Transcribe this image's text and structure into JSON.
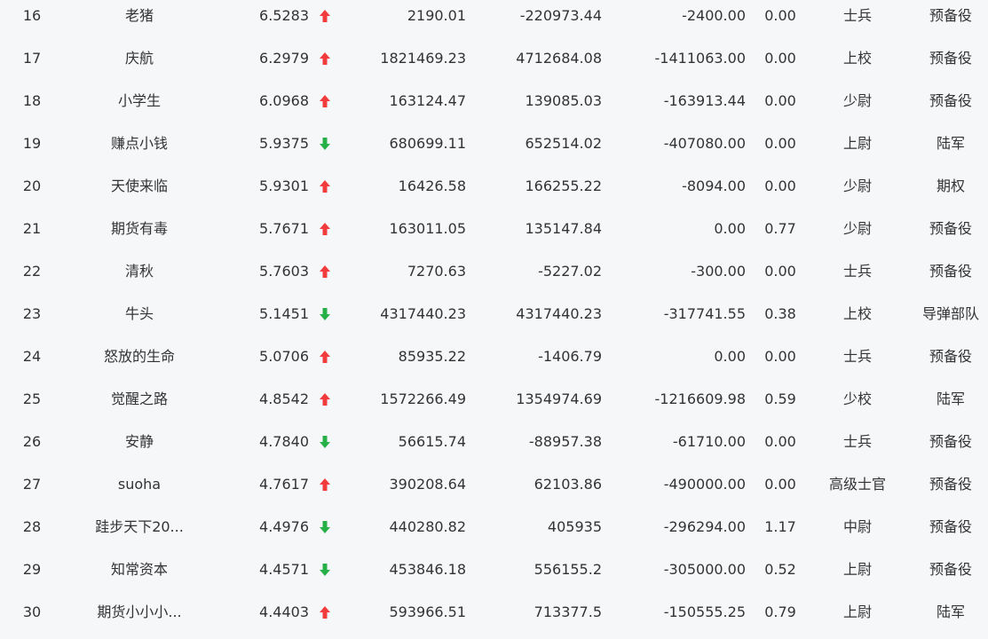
{
  "colors": {
    "up": "#f23c3c",
    "down": "#28b048",
    "text": "#333333",
    "background": "#f6f7f9"
  },
  "rows": [
    {
      "rank": "16",
      "name": "老猪",
      "score": "6.5283",
      "trend": "up",
      "value1": "2190.01",
      "value2": "-220973.44",
      "value3": "-2400.00",
      "ratio": "0.00",
      "rank_title": "士兵",
      "unit": "预备役"
    },
    {
      "rank": "17",
      "name": "庆航",
      "score": "6.2979",
      "trend": "up",
      "value1": "1821469.23",
      "value2": "4712684.08",
      "value3": "-1411063.00",
      "ratio": "0.00",
      "rank_title": "上校",
      "unit": "预备役"
    },
    {
      "rank": "18",
      "name": "小学生",
      "score": "6.0968",
      "trend": "up",
      "value1": "163124.47",
      "value2": "139085.03",
      "value3": "-163913.44",
      "ratio": "0.00",
      "rank_title": "少尉",
      "unit": "预备役"
    },
    {
      "rank": "19",
      "name": "赚点小钱",
      "score": "5.9375",
      "trend": "down",
      "value1": "680699.11",
      "value2": "652514.02",
      "value3": "-407080.00",
      "ratio": "0.00",
      "rank_title": "上尉",
      "unit": "陆军"
    },
    {
      "rank": "20",
      "name": "天使来临",
      "score": "5.9301",
      "trend": "up",
      "value1": "16426.58",
      "value2": "166255.22",
      "value3": "-8094.00",
      "ratio": "0.00",
      "rank_title": "少尉",
      "unit": "期权"
    },
    {
      "rank": "21",
      "name": "期货有毒",
      "score": "5.7671",
      "trend": "up",
      "value1": "163011.05",
      "value2": "135147.84",
      "value3": "0.00",
      "ratio": "0.77",
      "rank_title": "少尉",
      "unit": "预备役"
    },
    {
      "rank": "22",
      "name": "清秋",
      "score": "5.7603",
      "trend": "up",
      "value1": "7270.63",
      "value2": "-5227.02",
      "value3": "-300.00",
      "ratio": "0.00",
      "rank_title": "士兵",
      "unit": "预备役"
    },
    {
      "rank": "23",
      "name": "牛头",
      "score": "5.1451",
      "trend": "down",
      "value1": "4317440.23",
      "value2": "4317440.23",
      "value3": "-317741.55",
      "ratio": "0.38",
      "rank_title": "上校",
      "unit": "导弹部队"
    },
    {
      "rank": "24",
      "name": "怒放的生命",
      "score": "5.0706",
      "trend": "up",
      "value1": "85935.22",
      "value2": "-1406.79",
      "value3": "0.00",
      "ratio": "0.00",
      "rank_title": "士兵",
      "unit": "预备役"
    },
    {
      "rank": "25",
      "name": "觉醒之路",
      "score": "4.8542",
      "trend": "up",
      "value1": "1572266.49",
      "value2": "1354974.69",
      "value3": "-1216609.98",
      "ratio": "0.59",
      "rank_title": "少校",
      "unit": "陆军"
    },
    {
      "rank": "26",
      "name": "安静",
      "score": "4.7840",
      "trend": "down",
      "value1": "56615.74",
      "value2": "-88957.38",
      "value3": "-61710.00",
      "ratio": "0.00",
      "rank_title": "士兵",
      "unit": "预备役"
    },
    {
      "rank": "27",
      "name": "suoha",
      "score": "4.7617",
      "trend": "up",
      "value1": "390208.64",
      "value2": "62103.86",
      "value3": "-490000.00",
      "ratio": "0.00",
      "rank_title": "高级士官",
      "unit": "预备役"
    },
    {
      "rank": "28",
      "name": "跬步天下20...",
      "score": "4.4976",
      "trend": "down",
      "value1": "440280.82",
      "value2": "405935",
      "value3": "-296294.00",
      "ratio": "1.17",
      "rank_title": "中尉",
      "unit": "预备役"
    },
    {
      "rank": "29",
      "name": "知常资本",
      "score": "4.4571",
      "trend": "down",
      "value1": "453846.18",
      "value2": "556155.2",
      "value3": "-305000.00",
      "ratio": "0.52",
      "rank_title": "上尉",
      "unit": "预备役"
    },
    {
      "rank": "30",
      "name": "期货小小小...",
      "score": "4.4403",
      "trend": "up",
      "value1": "593966.51",
      "value2": "713377.5",
      "value3": "-150555.25",
      "ratio": "0.79",
      "rank_title": "上尉",
      "unit": "陆军"
    }
  ]
}
